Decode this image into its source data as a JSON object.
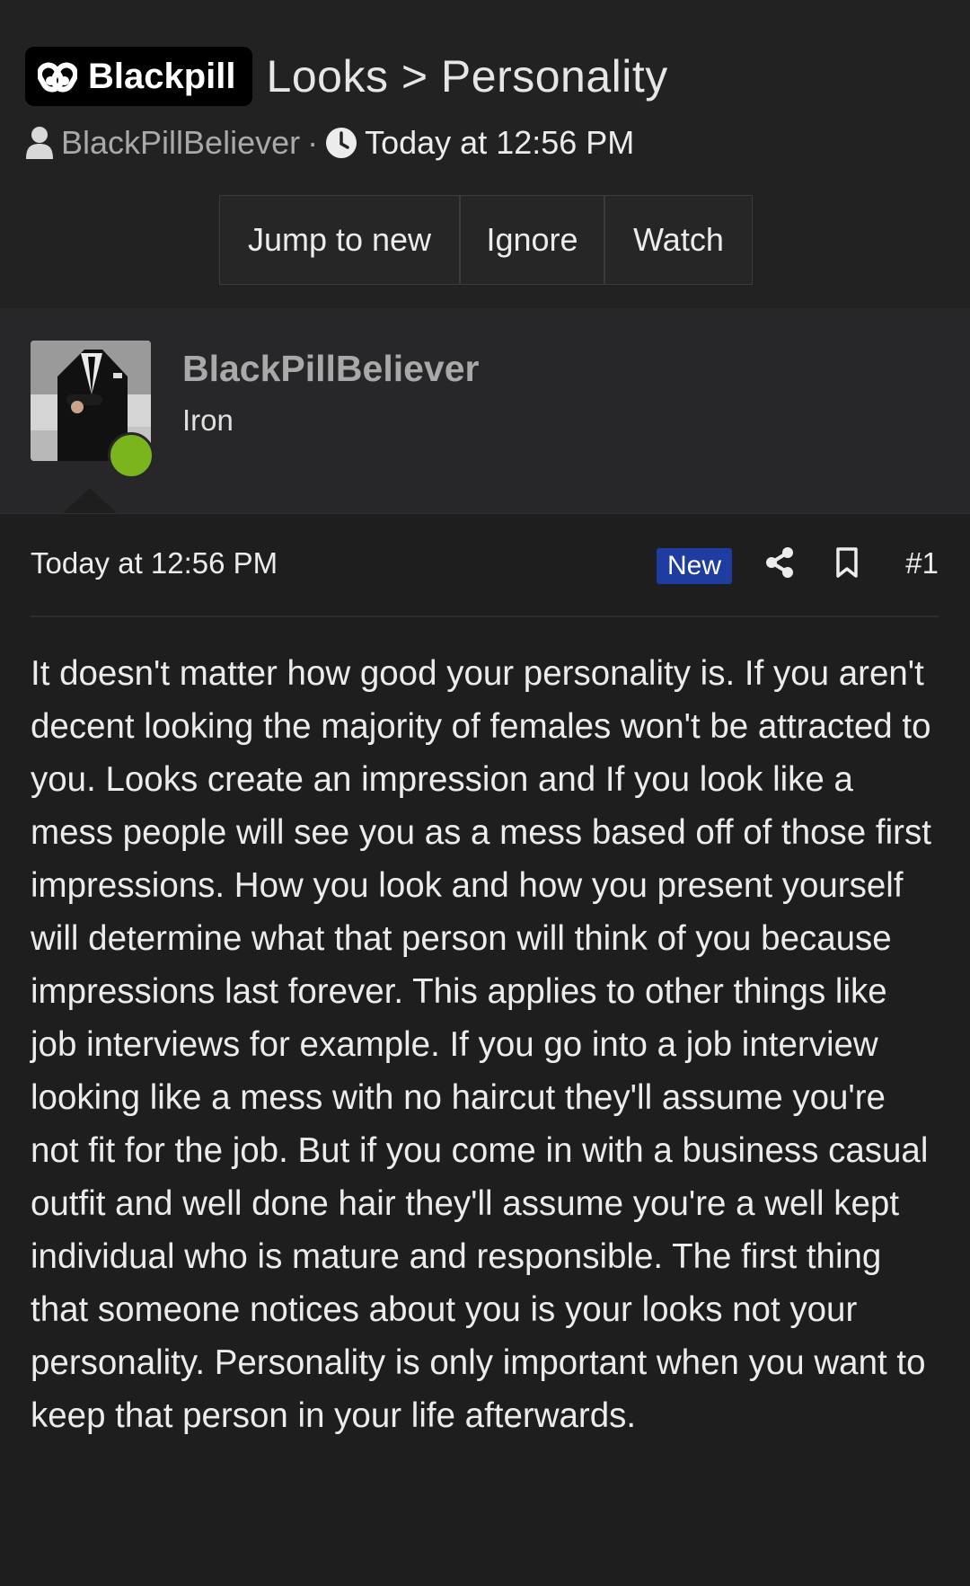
{
  "thread": {
    "prefix": "Blackpill",
    "title": "Looks > Personality",
    "author": "BlackPillBeliever",
    "separator": "·",
    "time": "Today at 12:56 PM"
  },
  "actions": {
    "jump_to_new": "Jump to new",
    "ignore": "Ignore",
    "watch": "Watch"
  },
  "user_card": {
    "username": "BlackPillBeliever",
    "user_title": "Iron",
    "online": true
  },
  "post": {
    "time": "Today at 12:56 PM",
    "new_badge": "New",
    "number": "#1",
    "body": "It doesn't matter how good your personality is. If you aren't decent looking the majority of females won't be attracted to you. Looks create an impression and If you look like a mess people will see you as a mess based off of those first impressions. How you look and how you present yourself will determine what that person will think of you because impressions last forever. This applies to other things like job interviews for example. If you go into a job interview looking like a mess with no haircut they'll assume you're not fit for the job. But if you come in with a business casual outfit and well done hair they'll assume you're a well kept individual who is mature and responsible. The first thing that someone notices about you is your looks not your personality. Personality is only important when you want to keep that person in your life afterwards."
  },
  "icons": {
    "prefix": "pill-icon",
    "author": "user-icon",
    "time": "clock-icon",
    "share": "share-icon",
    "bookmark": "bookmark-icon"
  },
  "colors": {
    "background": "#1e1e1f",
    "header_background": "#222223",
    "user_card_background": "#27272a",
    "online_indicator": "#7bb51d",
    "new_badge": "#1f3da0",
    "prefix_badge": "#000000"
  }
}
